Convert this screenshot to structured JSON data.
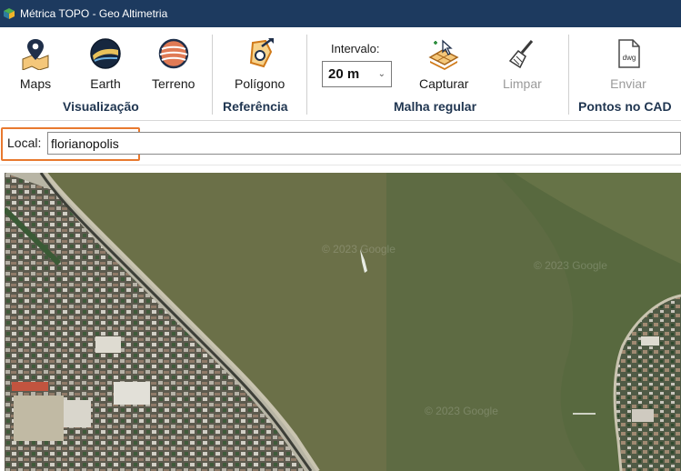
{
  "window": {
    "title": "Métrica TOPO - Geo Altimetria"
  },
  "ribbon": {
    "visualizacao": {
      "group_label": "Visualização",
      "maps_label": "Maps",
      "earth_label": "Earth",
      "terreno_label": "Terreno"
    },
    "referencia": {
      "group_label": "Referência",
      "poligono_label": "Polígono"
    },
    "malha": {
      "group_label": "Malha regular",
      "intervalo_label": "Intervalo:",
      "intervalo_value": "20 m",
      "capturar_label": "Capturar",
      "limpar_label": "Limpar"
    },
    "cad": {
      "group_label": "Pontos no CAD",
      "enviar_label": "Enviar"
    }
  },
  "local": {
    "label": "Local:",
    "value": "florianopolis"
  },
  "map": {
    "watermark": "© 2023 Google"
  },
  "colors": {
    "titlebar": "#1d3a5f",
    "group_label": "#1f3550",
    "highlight": "#e8792f",
    "water": "#6b7048"
  }
}
